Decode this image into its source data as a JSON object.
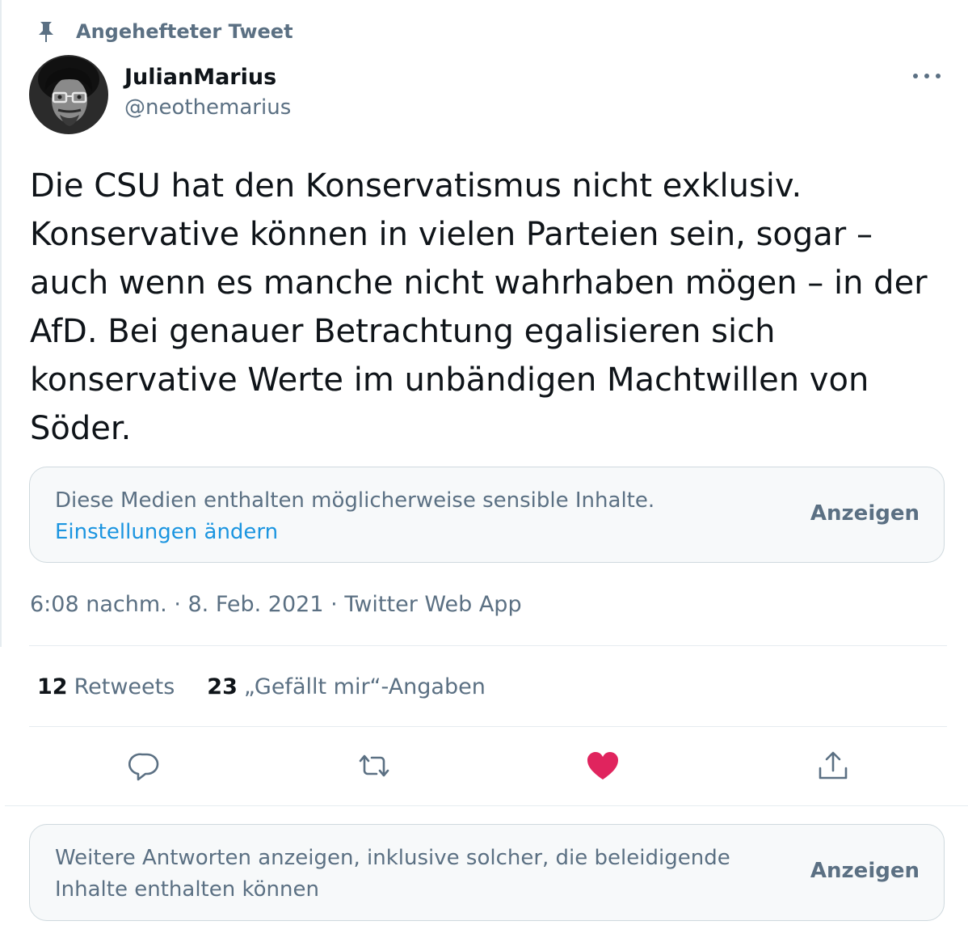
{
  "pinned": {
    "label": "Angehefteter Tweet"
  },
  "author": {
    "name": "JulianMarius",
    "handle": "@neothemarius"
  },
  "tweet": {
    "lines": [
      "Die CSU hat den Konservatismus nicht exklusiv.",
      "Konservative können in vielen Parteien sein, sogar –",
      "auch wenn es manche nicht wahrhaben mögen – in der",
      "AfD. Bei genauer Betrachtung egalisieren sich",
      "konservative Werte im unbändigen Machtwillen von",
      "Söder."
    ]
  },
  "sensitive_media": {
    "message": "Diese Medien enthalten möglicherweise sensible Inhalte.",
    "settings_link": "Einstellungen ändern",
    "show_label": "Anzeigen"
  },
  "meta": {
    "time": "6:08 nachm.",
    "separator": "·",
    "date": "8. Feb. 2021",
    "source": "Twitter Web App"
  },
  "stats": {
    "retweets_count": "12",
    "retweets_label": "Retweets",
    "likes_count": "23",
    "likes_label": "„Gefällt mir“-Angaben"
  },
  "actions": {
    "reply_icon": "reply-icon",
    "retweet_icon": "retweet-icon",
    "like_icon": "heart-icon",
    "share_icon": "share-icon",
    "like_active": true,
    "like_color": "#e0245e"
  },
  "more_replies": {
    "message": "Weitere Antworten anzeigen, inklusive solcher, die beleidigende Inhalte enthalten können",
    "show_label": "Anzeigen"
  },
  "colors": {
    "secondary_text": "#5b7083",
    "link": "#1b95e0",
    "primary_text": "#0f1419",
    "border": "#cfd9de",
    "box_bg": "#f7f9fa"
  }
}
